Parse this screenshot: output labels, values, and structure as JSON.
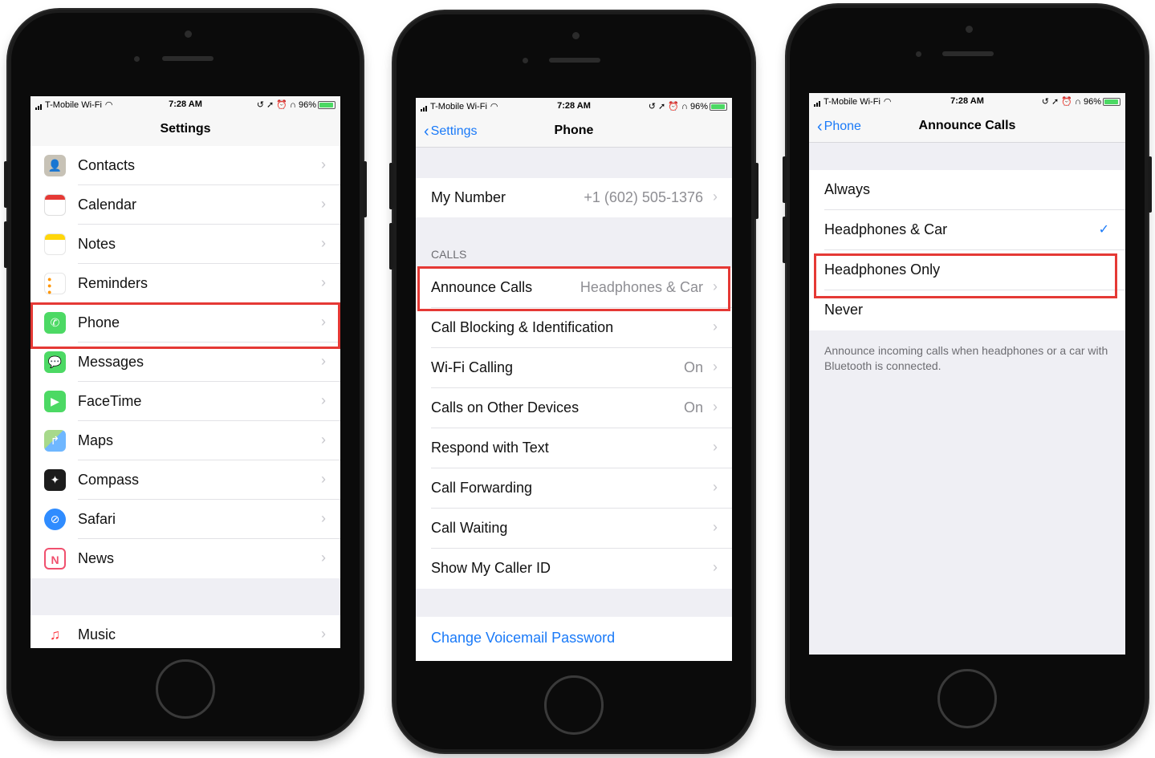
{
  "status_bar": {
    "carrier": "T-Mobile Wi-Fi",
    "time": "7:28 AM",
    "battery": "96%"
  },
  "screen1": {
    "title": "Settings",
    "items": [
      {
        "label": "Contacts",
        "icon": "contacts-icon",
        "color": "#b8b3a8"
      },
      {
        "label": "Calendar",
        "icon": "calendar-icon",
        "color": "#ffffff"
      },
      {
        "label": "Notes",
        "icon": "notes-icon",
        "color": "#ffffff"
      },
      {
        "label": "Reminders",
        "icon": "reminders-icon",
        "color": "#ffffff"
      },
      {
        "label": "Phone",
        "icon": "phone-icon",
        "color": "#4cd964"
      },
      {
        "label": "Messages",
        "icon": "messages-icon",
        "color": "#4cd964"
      },
      {
        "label": "FaceTime",
        "icon": "facetime-icon",
        "color": "#4cd964"
      },
      {
        "label": "Maps",
        "icon": "maps-icon",
        "color": "#6fb7ff"
      },
      {
        "label": "Compass",
        "icon": "compass-icon",
        "color": "#1c1c1c"
      },
      {
        "label": "Safari",
        "icon": "safari-icon",
        "color": "#2f8cff"
      },
      {
        "label": "News",
        "icon": "news-icon",
        "color": "#ffffff"
      }
    ],
    "music": {
      "label": "Music",
      "icon": "music-icon"
    }
  },
  "screen2": {
    "back_label": "Settings",
    "title": "Phone",
    "my_number": {
      "label": "My Number",
      "value": "+1 (602) 505-1376"
    },
    "calls_header": "CALLS",
    "calls_items": [
      {
        "label": "Announce Calls",
        "value": "Headphones & Car"
      },
      {
        "label": "Call Blocking & Identification",
        "value": ""
      },
      {
        "label": "Wi-Fi Calling",
        "value": "On"
      },
      {
        "label": "Calls on Other Devices",
        "value": "On"
      },
      {
        "label": "Respond with Text",
        "value": ""
      },
      {
        "label": "Call Forwarding",
        "value": ""
      },
      {
        "label": "Call Waiting",
        "value": ""
      },
      {
        "label": "Show My Caller ID",
        "value": ""
      }
    ],
    "voicemail_link": "Change Voicemail Password"
  },
  "screen3": {
    "back_label": "Phone",
    "title": "Announce Calls",
    "options": [
      {
        "label": "Always",
        "selected": false
      },
      {
        "label": "Headphones & Car",
        "selected": true
      },
      {
        "label": "Headphones Only",
        "selected": false
      },
      {
        "label": "Never",
        "selected": false
      }
    ],
    "footer": "Announce incoming calls when headphones or a car with Bluetooth is connected."
  },
  "colors": {
    "accent": "#1a7af8",
    "highlight": "#e53935",
    "phone_body": "#0b0b0b"
  }
}
